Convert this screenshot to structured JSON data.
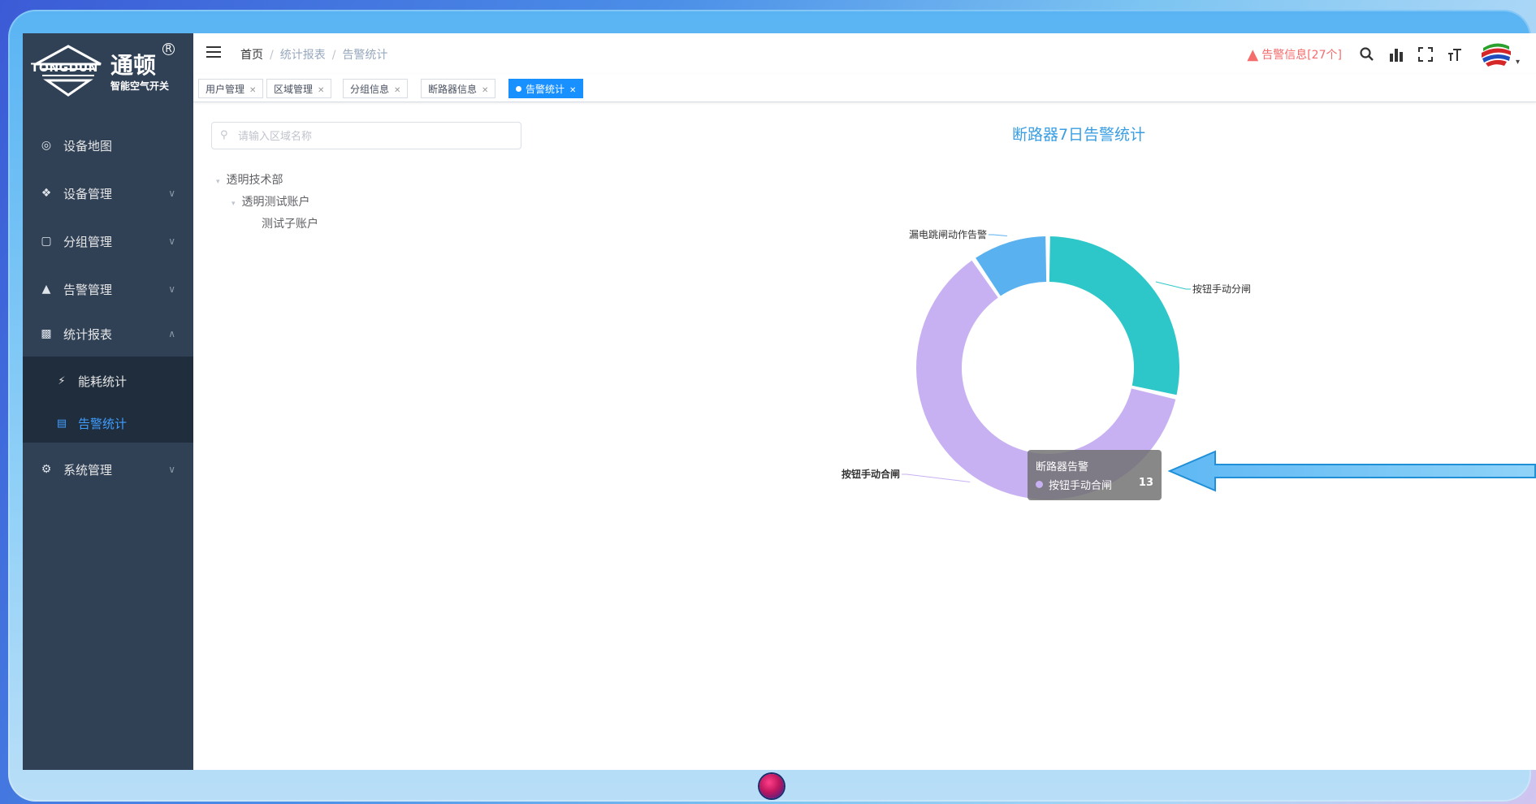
{
  "app": {
    "logo_en": "TONGDUN",
    "logo_cn": "通顿",
    "logo_sub": "智能空气开关",
    "logo_reg": "R"
  },
  "sidebar": {
    "items": [
      {
        "label": "设备地图",
        "icon": "map-pin-icon"
      },
      {
        "label": "设备管理",
        "icon": "device-icon"
      },
      {
        "label": "分组管理",
        "icon": "group-icon"
      },
      {
        "label": "告警管理",
        "icon": "alarm-icon"
      },
      {
        "label": "统计报表",
        "icon": "chart-icon"
      },
      {
        "label": "系统管理",
        "icon": "gear-icon"
      }
    ],
    "sub_items": [
      {
        "label": "能耗统计",
        "icon": "bolt-icon"
      },
      {
        "label": "告警统计",
        "icon": "report-icon"
      }
    ]
  },
  "header": {
    "breadcrumb": [
      "首页",
      "统计报表",
      "告警统计"
    ],
    "alarm_text": "告警信息[27个]"
  },
  "tags": [
    "用户管理",
    "区域管理",
    "分组信息",
    "断路器信息",
    "告警统计"
  ],
  "search": {
    "placeholder": "请输入区域名称"
  },
  "tree": [
    "透明技术部",
    "透明测试账户",
    "测试子账户"
  ],
  "chart_data": {
    "type": "pie",
    "title": "断路器7日告警统计",
    "series_name": "断路器告警",
    "slices": [
      {
        "label": "按钮手动分闸",
        "value": 6,
        "color": "#2ec7c9"
      },
      {
        "label": "按钮手动合闸",
        "value": 13,
        "color": "#c7b1f2"
      },
      {
        "label": "漏电跳闸动作告警",
        "value": 2,
        "color": "#5ab1ef"
      }
    ],
    "tooltip": {
      "title": "断路器告警",
      "name": "按钮手动合闸",
      "value": "13"
    }
  },
  "colors": {
    "sidebar_bg": "#304156",
    "accent": "#1890ff",
    "title": "#3a9ee3",
    "alarm": "#f56c6c"
  }
}
